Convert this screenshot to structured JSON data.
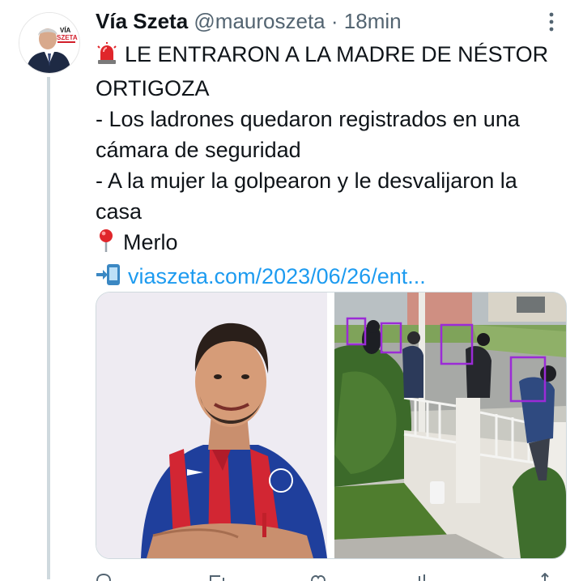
{
  "tweet": {
    "display_name": "Vía Szeta",
    "handle": "@mauroszeta",
    "separator": "·",
    "time": "18min",
    "more_icon": "more-vertical-icon",
    "avatar_text_top": "VÍA",
    "avatar_text_bottom": "SZETA",
    "lines": [
      "LE ENTRARON A LA MADRE DE NÉSTOR",
      "ORTIGOZA",
      "- Los ladrones quedaron registrados en una",
      "cámara de seguridad",
      "- A la mujer la golpearon y le desvalijaron la",
      "casa",
      "Merlo",
      "viaszeta.com/2023/06/26/ent..."
    ],
    "icons": {
      "siren": "police-siren-icon",
      "pin": "round-pushpin-icon",
      "phone": "mobile-arrow-icon"
    },
    "colors": {
      "link": "#1d9bf0",
      "text": "#0f1419",
      "secondary": "#536471",
      "detection_box": "#9b2bd6"
    }
  },
  "media": {
    "photo_left": "footballer-portrait-photo",
    "photo_right": "security-camera-photo"
  },
  "actions": [
    "reply-icon",
    "retweet-icon",
    "like-icon",
    "views-icon",
    "share-icon"
  ]
}
